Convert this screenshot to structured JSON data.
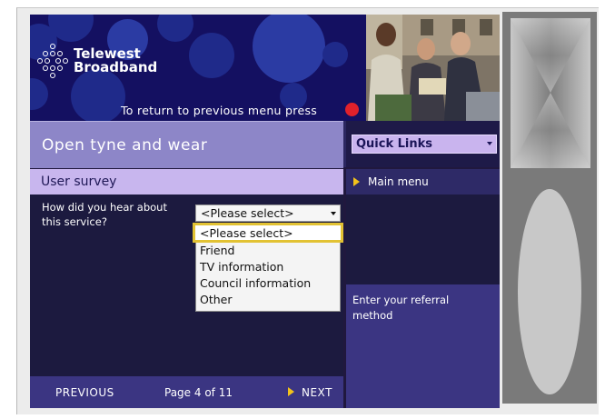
{
  "header": {
    "logo_line1": "Telewest",
    "logo_line2": "Broadband",
    "return_text": "To return to previous menu press",
    "return_key_color": "#e0212b"
  },
  "title": "Open tyne and wear",
  "quick_links": {
    "label": "Quick Links"
  },
  "section_title": "User survey",
  "side_menu": {
    "main_menu": "Main menu"
  },
  "question": {
    "line1": "How did you hear about",
    "line2": "this service?"
  },
  "select": {
    "value": "<Please select>",
    "options": [
      "<Please select>",
      "Friend",
      "TV information",
      "Council information",
      "Other"
    ],
    "highlighted_index": 0
  },
  "hint": {
    "line1": "Enter your referral",
    "line2": "method"
  },
  "footer": {
    "previous": "PREVIOUS",
    "page": "Page 4 of 11",
    "next": "NEXT"
  },
  "colors": {
    "accent": "#f2c21b",
    "header_bg": "#141061",
    "title_band": "#8d86c8",
    "survey_bar": "#c8b6ee",
    "highlight": "#e2c233"
  }
}
